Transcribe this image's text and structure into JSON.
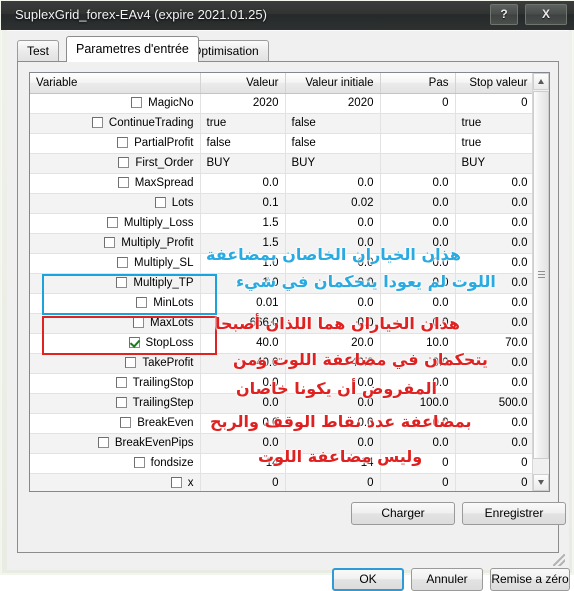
{
  "window": {
    "title": "SuplexGrid_forex-EAv4 (expire 2021.01.25)",
    "help_label": "?",
    "close_label": "X"
  },
  "tabs": [
    {
      "label": "Test",
      "active": false
    },
    {
      "label": "Parametres d'entrée",
      "active": true
    },
    {
      "label": "Optimisation",
      "active": false
    }
  ],
  "grid": {
    "columns": [
      "Variable",
      "Valeur",
      "Valeur initiale",
      "Pas",
      "Stop valeur"
    ],
    "rows": [
      {
        "name": "MagicNo",
        "checked": false,
        "valeur": "2020",
        "initiale": "2020",
        "pas": "0",
        "stop": "0",
        "text": false
      },
      {
        "name": "ContinueTrading",
        "checked": false,
        "valeur": "true",
        "initiale": "false",
        "pas": "",
        "stop": "true",
        "text": true
      },
      {
        "name": "PartialProfit",
        "checked": false,
        "valeur": "false",
        "initiale": "false",
        "pas": "",
        "stop": "true",
        "text": true
      },
      {
        "name": "First_Order",
        "checked": false,
        "valeur": "BUY",
        "initiale": "BUY",
        "pas": "",
        "stop": "BUY",
        "text": true
      },
      {
        "name": "MaxSpread",
        "checked": false,
        "valeur": "0.0",
        "initiale": "0.0",
        "pas": "0.0",
        "stop": "0.0",
        "text": false
      },
      {
        "name": "Lots",
        "checked": false,
        "valeur": "0.1",
        "initiale": "0.02",
        "pas": "0.0",
        "stop": "0.0",
        "text": false
      },
      {
        "name": "Multiply_Loss",
        "checked": false,
        "valeur": "1.5",
        "initiale": "0.0",
        "pas": "0.0",
        "stop": "0.0",
        "text": false
      },
      {
        "name": "Multiply_Profit",
        "checked": false,
        "valeur": "1.5",
        "initiale": "0.0",
        "pas": "0.0",
        "stop": "0.0",
        "text": false
      },
      {
        "name": "Multiply_SL",
        "checked": false,
        "valeur": "1.0",
        "initiale": "0.0",
        "pas": "0.0",
        "stop": "0.0",
        "text": false
      },
      {
        "name": "Multiply_TP",
        "checked": false,
        "valeur": "1.0",
        "initiale": "0.0",
        "pas": "0.0",
        "stop": "0.0",
        "text": false
      },
      {
        "name": "MinLots",
        "checked": false,
        "valeur": "0.01",
        "initiale": "0.0",
        "pas": "0.0",
        "stop": "0.0",
        "text": false
      },
      {
        "name": "MaxLots",
        "checked": false,
        "valeur": "666.0",
        "initiale": "0.0",
        "pas": "0.0",
        "stop": "0.0",
        "text": false
      },
      {
        "name": "StopLoss",
        "checked": true,
        "valeur": "40.0",
        "initiale": "20.0",
        "pas": "10.0",
        "stop": "70.0",
        "text": false
      },
      {
        "name": "TakeProfit",
        "checked": false,
        "valeur": "40.0",
        "initiale": "40.0",
        "pas": "0.0",
        "stop": "0.0",
        "text": false
      },
      {
        "name": "TrailingStop",
        "checked": false,
        "valeur": "0.0",
        "initiale": "0.0",
        "pas": "0.0",
        "stop": "0.0",
        "text": false
      },
      {
        "name": "TrailingStep",
        "checked": false,
        "valeur": "0.0",
        "initiale": "0.0",
        "pas": "100.0",
        "stop": "500.0",
        "text": false
      },
      {
        "name": "BreakEven",
        "checked": false,
        "valeur": "0.0",
        "initiale": "0.0",
        "pas": "0.0",
        "stop": "0.0",
        "text": false
      },
      {
        "name": "BreakEvenPips",
        "checked": false,
        "valeur": "0.0",
        "initiale": "0.0",
        "pas": "0.0",
        "stop": "0.0",
        "text": false
      },
      {
        "name": "fondsize",
        "checked": false,
        "valeur": "14",
        "initiale": "14",
        "pas": "0",
        "stop": "0",
        "text": false
      },
      {
        "name": "x",
        "checked": false,
        "valeur": "0",
        "initiale": "0",
        "pas": "0",
        "stop": "0",
        "text": false
      }
    ]
  },
  "annotations": {
    "blue_color": "#29abe2",
    "red_color": "#e02121",
    "blue_line1": "هذان الخياران الخاصان بمضاعفة",
    "blue_line2": "اللوت لم يعودا يتحكمان في شيء",
    "red_line1": "هذان الخياران هما اللذان أصبحا",
    "red_line2": "يتحكمان في مضاعفة اللوت ومن",
    "red_line3": "المفروض أن يكونا خاصان",
    "red_line4": "بمضاعفة عدد نقاط الوقف والربح",
    "red_line5": "وليس مضاعفة اللوت"
  },
  "panel_buttons": {
    "charger": "Charger",
    "enregistrer": "Enregistrer"
  },
  "footer_buttons": {
    "ok": "OK",
    "annuler": "Annuler",
    "reset": "Remise a zéro"
  }
}
